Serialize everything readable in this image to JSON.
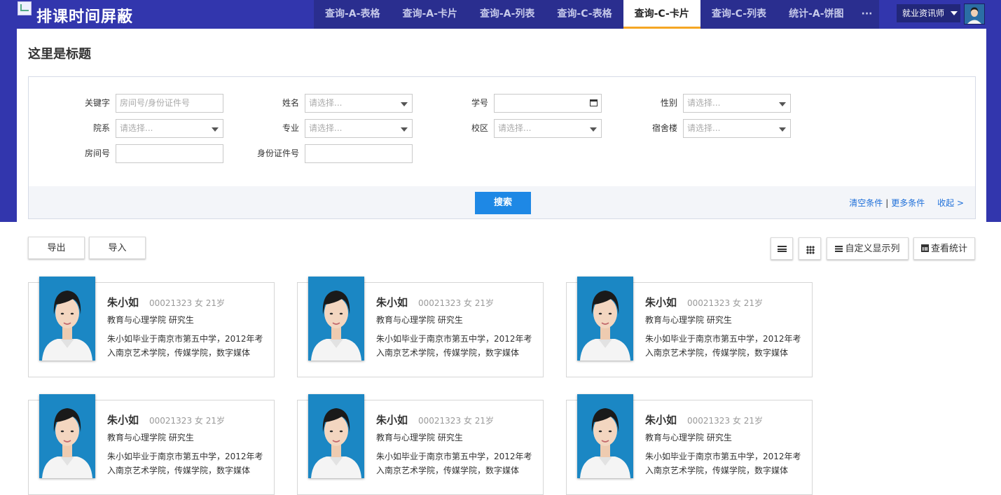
{
  "app": {
    "title": "排课时间屏蔽"
  },
  "nav": {
    "tabs": [
      {
        "label": "查询-A-表格",
        "active": false
      },
      {
        "label": "查询-A-卡片",
        "active": false
      },
      {
        "label": "查询-A-列表",
        "active": false
      },
      {
        "label": "查询-C-表格",
        "active": false
      },
      {
        "label": "查询-C-卡片",
        "active": true
      },
      {
        "label": "查询-C-列表",
        "active": false
      },
      {
        "label": "统计-A-饼图",
        "active": false
      }
    ],
    "more_label": "···"
  },
  "user": {
    "role": "就业资讯师"
  },
  "page": {
    "title": "这里是标题"
  },
  "filters": {
    "keyword": {
      "label": "关键字",
      "placeholder": "房间号/身份证件号"
    },
    "name": {
      "label": "姓名",
      "placeholder": "请选择..."
    },
    "student_id": {
      "label": "学号",
      "placeholder": ""
    },
    "gender": {
      "label": "性别",
      "placeholder": "请选择..."
    },
    "college": {
      "label": "院系",
      "placeholder": "请选择..."
    },
    "major": {
      "label": "专业",
      "placeholder": "请选择..."
    },
    "campus": {
      "label": "校区",
      "placeholder": "请选择..."
    },
    "dorm": {
      "label": "宿舍楼",
      "placeholder": "请选择..."
    },
    "room": {
      "label": "房间号",
      "placeholder": ""
    },
    "id_number": {
      "label": "身份证件号",
      "placeholder": ""
    }
  },
  "actions": {
    "search_label": "搜索",
    "clear_label": "清空条件",
    "more_label": "更多条件",
    "collapse_label": "收起 >"
  },
  "toolbar": {
    "export_label": "导出",
    "import_label": "导入",
    "custom_columns_label": "自定义显示列",
    "stats_label": "查看统计"
  },
  "cards": [
    {
      "name": "朱小如",
      "meta": "00021323 女 21岁",
      "dept": "教育与心理学院 研究生",
      "desc": "朱小如毕业于南京市第五中学，2012年考入南京艺术学院，传媒学院，数字媒体"
    },
    {
      "name": "朱小如",
      "meta": "00021323 女 21岁",
      "dept": "教育与心理学院 研究生",
      "desc": "朱小如毕业于南京市第五中学，2012年考入南京艺术学院，传媒学院，数字媒体"
    },
    {
      "name": "朱小如",
      "meta": "00021323 女 21岁",
      "dept": "教育与心理学院 研究生",
      "desc": "朱小如毕业于南京市第五中学，2012年考入南京艺术学院，传媒学院，数字媒体"
    },
    {
      "name": "朱小如",
      "meta": "00021323 女 21岁",
      "dept": "教育与心理学院 研究生",
      "desc": "朱小如毕业于南京市第五中学，2012年考入南京艺术学院，传媒学院，数字媒体"
    },
    {
      "name": "朱小如",
      "meta": "00021323 女 21岁",
      "dept": "教育与心理学院 研究生",
      "desc": "朱小如毕业于南京市第五中学，2012年考入南京艺术学院，传媒学院，数字媒体"
    },
    {
      "name": "朱小如",
      "meta": "00021323 女 21岁",
      "dept": "教育与心理学院 研究生",
      "desc": "朱小如毕业于南京市第五中学，2012年考入南京艺术学院，传媒学院，数字媒体"
    }
  ],
  "colors": {
    "header_bg": "#3236ad",
    "nav_bg": "#2a2e8f",
    "active_tab_underline": "#f5a623",
    "primary_button": "#1e88e5",
    "link": "#1e6fd9",
    "photo_bg": "#1b87c4"
  }
}
